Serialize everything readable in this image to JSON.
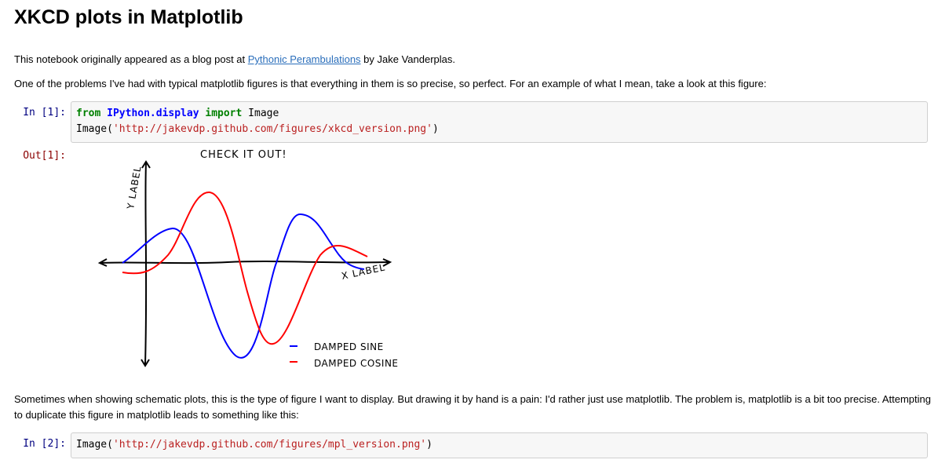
{
  "title": "XKCD plots in Matplotlib",
  "intro": {
    "prefix": "This notebook originally appeared as a blog post at ",
    "link_text": "Pythonic Perambulations",
    "suffix": " by Jake Vanderplas."
  },
  "para1": "One of the problems I've had with typical matplotlib figures is that everything in them is so precise, so perfect. For an example of what I mean, take a look at this figure:",
  "cell1": {
    "prompt": "In [1]:",
    "line1": {
      "kw1": "from",
      "module": "IPython.display",
      "kw2": "import",
      "name": "Image"
    },
    "line2": {
      "call": "Image(",
      "url": "'http://jakevdp.github.com/figures/xkcd_version.png'",
      "close": ")"
    }
  },
  "out1": {
    "prompt": "Out[1]:",
    "figure": {
      "title": "CHECK IT OUT!",
      "xlabel": "X LABEL",
      "ylabel": "Y LABEL",
      "legend": [
        {
          "label": "DAMPED SINE",
          "color": "#0000ff"
        },
        {
          "label": "DAMPED COSINE",
          "color": "#ff0000"
        }
      ]
    }
  },
  "para2": "Sometimes when showing schematic plots, this is the type of figure I want to display. But drawing it by hand is a pain: I'd rather just use matplotlib. The problem is, matplotlib is a bit too precise. Attempting to duplicate this figure in matplotlib leads to something like this:",
  "cell2": {
    "prompt": "In [2]:",
    "call": "Image(",
    "url": "'http://jakevdp.github.com/figures/mpl_version.png'",
    "close": ")"
  },
  "colors": {
    "link": "#2a6ebb",
    "keyword": "#008000",
    "module": "#0000ff",
    "string": "#ba2121",
    "in_prompt": "#000080",
    "out_prompt": "#8b0000"
  }
}
